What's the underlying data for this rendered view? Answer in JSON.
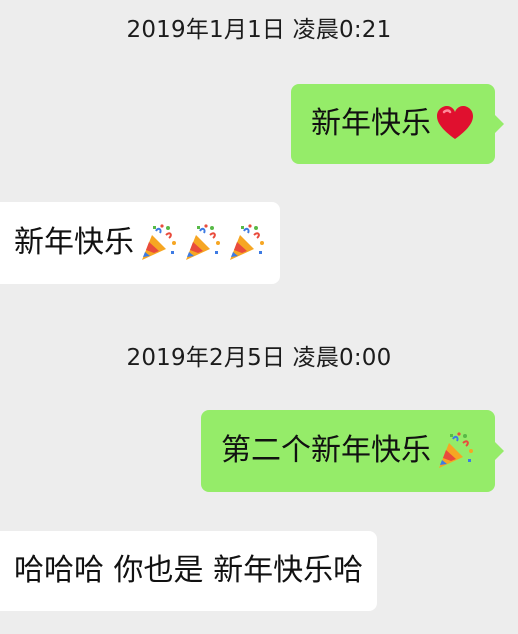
{
  "conversation": {
    "timestamps": [
      "2019年1月1日 凌晨0:21",
      "2019年2月5日 凌晨0:00"
    ],
    "messages": [
      {
        "side": "sent",
        "text": "新年快乐",
        "emojis": [
          "red-heart"
        ]
      },
      {
        "side": "received",
        "text": "新年快乐",
        "emojis": [
          "party-popper",
          "party-popper",
          "party-popper"
        ]
      },
      {
        "side": "sent",
        "text": "第二个新年快乐",
        "emojis": [
          "party-popper"
        ]
      },
      {
        "side": "received",
        "text": "哈哈哈 你也是 新年快乐哈",
        "emojis": []
      }
    ]
  },
  "colors": {
    "background": "#ededed",
    "sent_bubble": "#95ec69",
    "received_bubble": "#ffffff",
    "heart": "#e0102f"
  }
}
